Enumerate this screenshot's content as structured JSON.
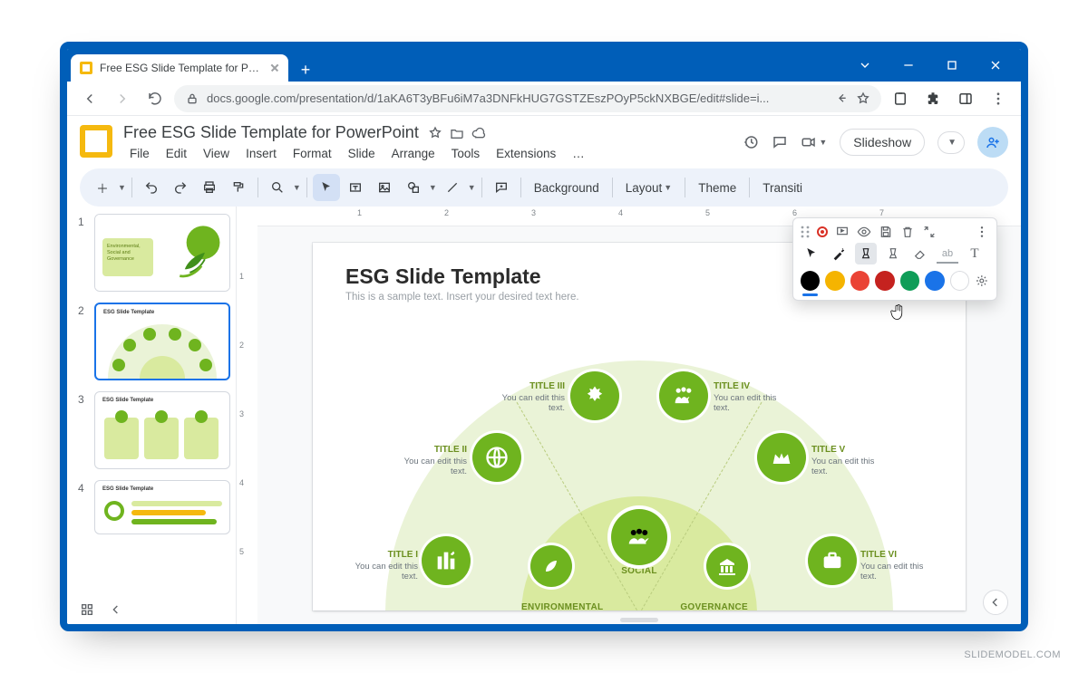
{
  "browser": {
    "tab_title": "Free ESG Slide Template for Powe",
    "url": "docs.google.com/presentation/d/1aKA6T3yBFu6iM7a3DNFkHUG7GSTZEszPOyP5ckNXBGE/edit#slide=i..."
  },
  "doc": {
    "title": "Free ESG Slide Template for PowerPoint"
  },
  "menus": [
    "File",
    "Edit",
    "View",
    "Insert",
    "Format",
    "Slide",
    "Arrange",
    "Tools",
    "Extensions",
    "…"
  ],
  "header_buttons": {
    "slideshow": "Slideshow"
  },
  "toolbar": {
    "background": "Background",
    "layout": "Layout",
    "theme": "Theme",
    "transition": "Transiti"
  },
  "ruler": {
    "marks": [
      "1",
      "2",
      "3",
      "4",
      "5",
      "6",
      "7"
    ],
    "vmarks": [
      "1",
      "2",
      "3",
      "4",
      "5"
    ]
  },
  "slide": {
    "title": "ESG Slide Template",
    "subtitle": "This is a sample text. Insert your desired text here.",
    "center_label": "SOCIAL",
    "categories": {
      "env": "ENVIRONMENTAL",
      "gov": "GOVERNANCE"
    },
    "nodes": {
      "n1": {
        "title": "TITLE I",
        "body": "You can edit this text."
      },
      "n2": {
        "title": "TITLE II",
        "body": "You can edit this text."
      },
      "n3": {
        "title": "TITLE III",
        "body": "You can edit this text."
      },
      "n4": {
        "title": "TITLE IV",
        "body": "You can edit this text."
      },
      "n5": {
        "title": "TITLE V",
        "body": "You can edit this text."
      },
      "n6": {
        "title": "TITLE VI",
        "body": "You can edit this text."
      }
    }
  },
  "annotate": {
    "colors": [
      "#000000",
      "#f5b400",
      "#ea4335",
      "#c5221f",
      "#0f9d58",
      "#1a73e8",
      "#ffffff"
    ]
  },
  "thumbnails": {
    "t1": "Environmental, Social and Governance",
    "t2": "ESG Slide Template",
    "t3": "ESG Slide Template",
    "t4": "ESG Slide Template"
  },
  "watermark": "SLIDEMODEL.COM"
}
